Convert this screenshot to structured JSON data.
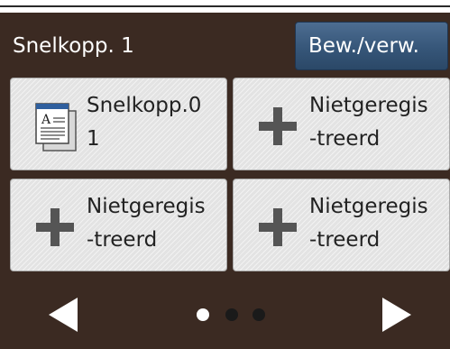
{
  "header": {
    "title": "Snelkopp. 1",
    "edit_button_label": "Bew./verw."
  },
  "tiles": [
    {
      "line1": "Snelkopp.0",
      "line2": "1",
      "icon": "document-icon",
      "registered": true
    },
    {
      "line1": "Nietgeregis",
      "line2": "-treerd",
      "icon": "plus-icon",
      "registered": false
    },
    {
      "line1": "Nietgeregis",
      "line2": "-treerd",
      "icon": "plus-icon",
      "registered": false
    },
    {
      "line1": "Nietgeregis",
      "line2": "-treerd",
      "icon": "plus-icon",
      "registered": false
    }
  ],
  "pagination": {
    "page_count": 3,
    "current_page": 1
  },
  "icons": {
    "previous": "left-triangle-icon",
    "next": "right-triangle-icon"
  },
  "colors": {
    "background": "#3b2a22",
    "edit_button": "#365679",
    "tile": "#e3e3e3",
    "active_dot": "#ffffff",
    "inactive_dot": "#1a1a1a",
    "plus": "#555555"
  }
}
